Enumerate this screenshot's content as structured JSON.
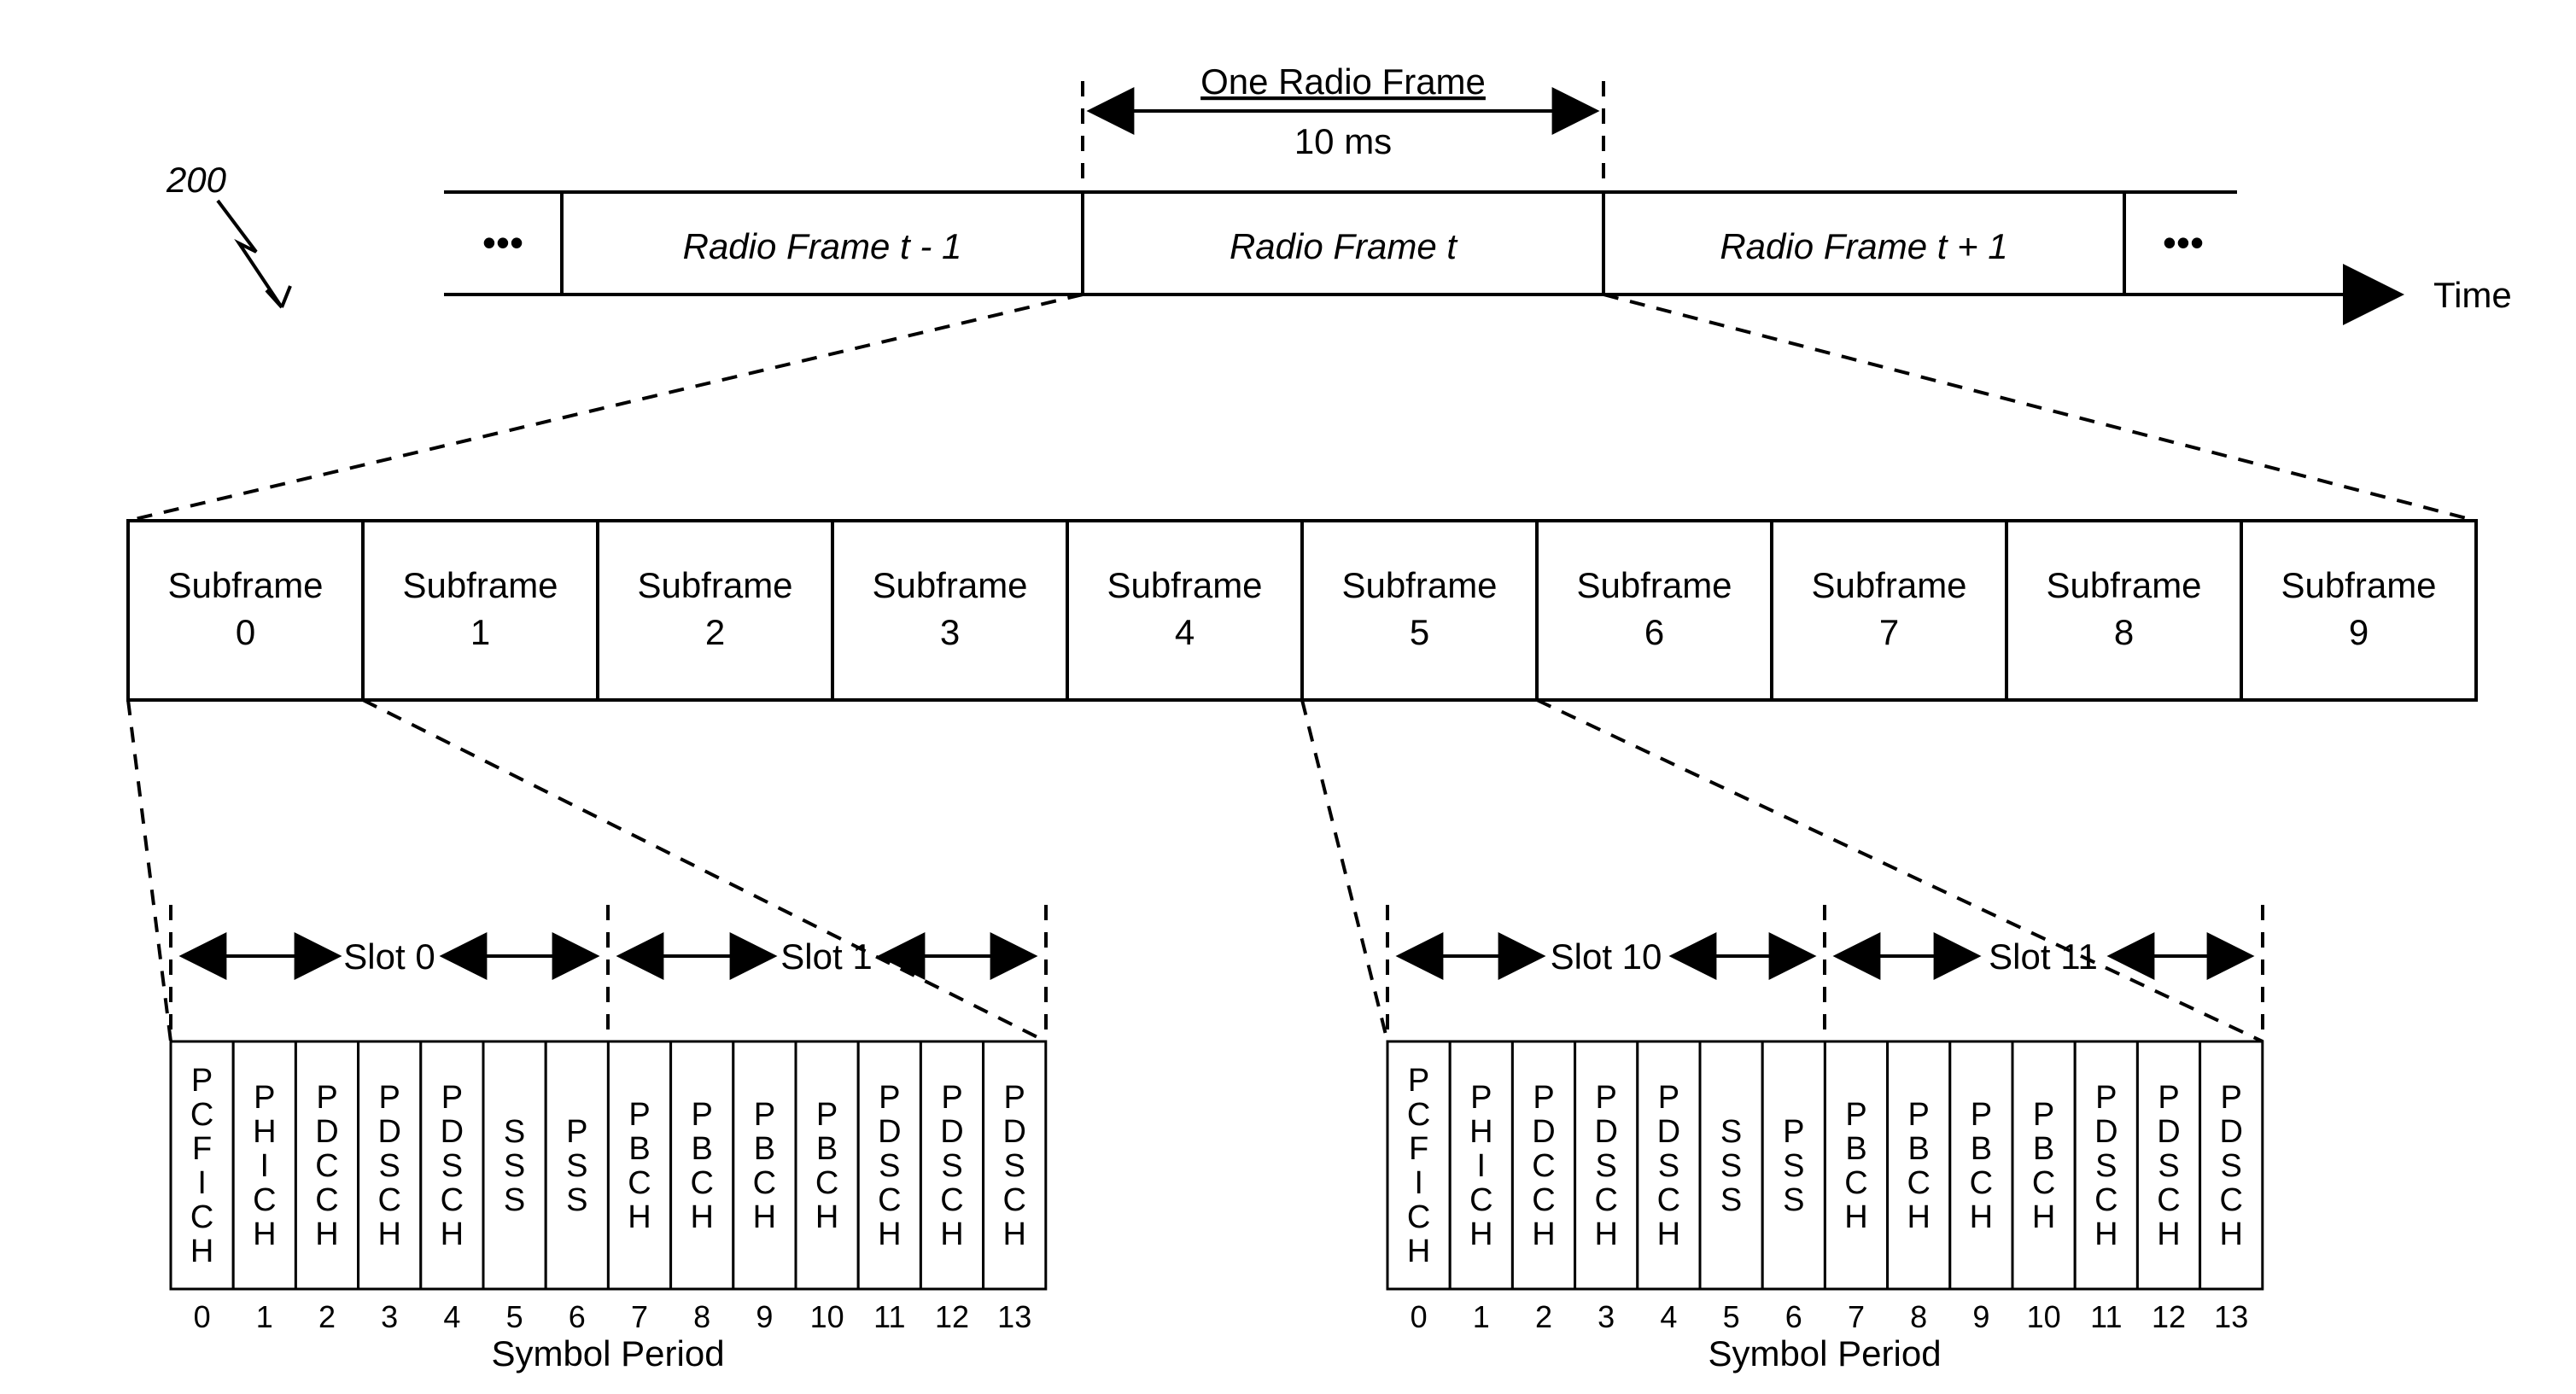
{
  "figure_number": "200",
  "time_axis_label": "Time",
  "frame_annotation": {
    "title": "One Radio Frame",
    "duration": "10 ms"
  },
  "ellipsis": "•••",
  "radio_frames": [
    "Radio Frame   t - 1",
    "Radio Frame   t",
    "Radio Frame   t + 1"
  ],
  "subframes": [
    {
      "line1": "Subframe",
      "line2": "0"
    },
    {
      "line1": "Subframe",
      "line2": "1"
    },
    {
      "line1": "Subframe",
      "line2": "2"
    },
    {
      "line1": "Subframe",
      "line2": "3"
    },
    {
      "line1": "Subframe",
      "line2": "4"
    },
    {
      "line1": "Subframe",
      "line2": "5"
    },
    {
      "line1": "Subframe",
      "line2": "6"
    },
    {
      "line1": "Subframe",
      "line2": "7"
    },
    {
      "line1": "Subframe",
      "line2": "8"
    },
    {
      "line1": "Subframe",
      "line2": "9"
    }
  ],
  "slots": {
    "s0": "Slot 0",
    "s1": "Slot 1",
    "s10": "Slot 10",
    "s11": "Slot 11"
  },
  "symbol_period_label": "Symbol Period",
  "symbol_indices": [
    "0",
    "1",
    "2",
    "3",
    "4",
    "5",
    "6",
    "7",
    "8",
    "9",
    "10",
    "11",
    "12",
    "13"
  ],
  "symbols_left": [
    "PCFICH",
    "PHICH",
    "PDCCH",
    "PDSCH",
    "PDSCH",
    "SSS",
    "PSS",
    "PBCH",
    "PBCH",
    "PBCH",
    "PBCH",
    "PDSCH",
    "PDSCH",
    "PDSCH"
  ],
  "symbols_right": [
    "PCFICH",
    "PHICH",
    "PDCCH",
    "PDSCH",
    "PDSCH",
    "SSS",
    "PSS",
    "PBCH",
    "PBCH",
    "PBCH",
    "PBCH",
    "PDSCH",
    "PDSCH",
    "PDSCH"
  ]
}
